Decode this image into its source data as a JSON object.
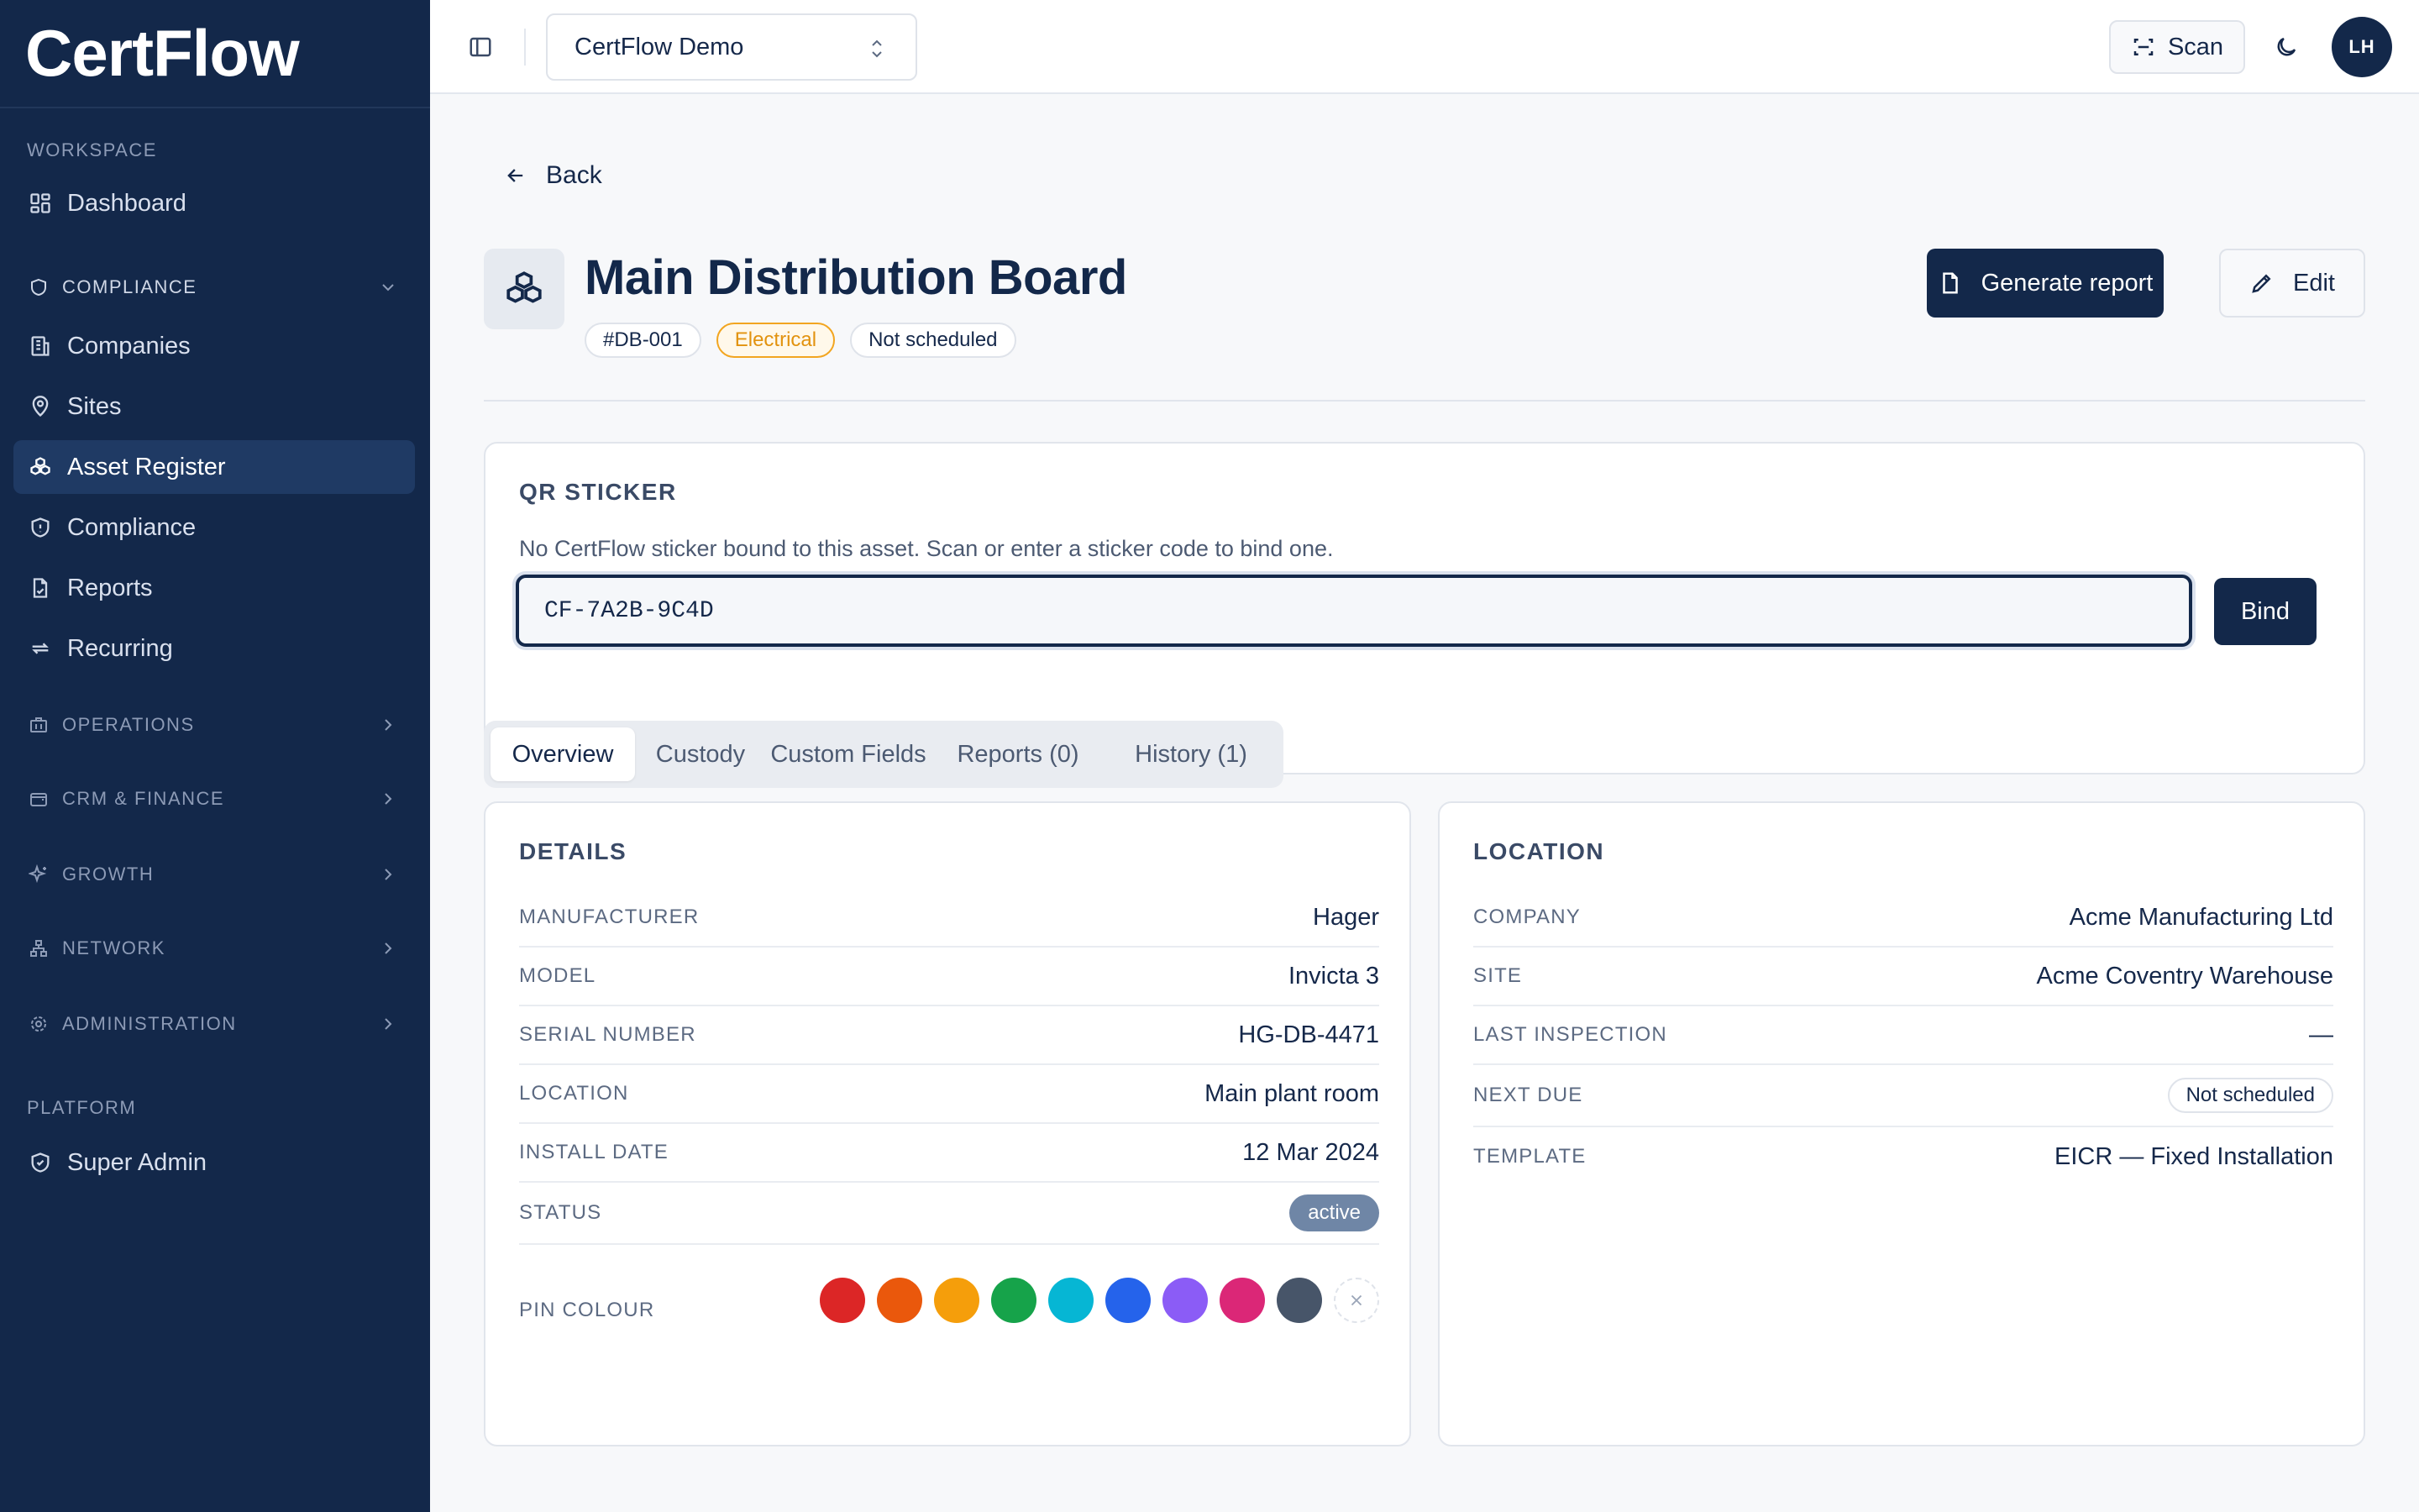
{
  "app": {
    "name": "CertFlow"
  },
  "sidebar": {
    "sections": {
      "workspace": "WORKSPACE",
      "platform": "PLATFORM"
    },
    "dashboard": "Dashboard",
    "compliance_group": "COMPLIANCE",
    "compliance_items": [
      "Companies",
      "Sites",
      "Asset Register",
      "Compliance",
      "Reports",
      "Recurring"
    ],
    "groups": [
      "OPERATIONS",
      "CRM & FINANCE",
      "GROWTH",
      "NETWORK",
      "ADMINISTRATION"
    ],
    "super_admin": "Super Admin",
    "active_item": "Asset Register"
  },
  "topbar": {
    "workspace": "CertFlow Demo",
    "scan_label": "Scan",
    "avatar_initials": "LH"
  },
  "page": {
    "back_label": "Back",
    "title": "Main Distribution Board",
    "tags": {
      "id": "#DB-001",
      "category": "Electrical",
      "schedule": "Not scheduled"
    },
    "generate_report_label": "Generate report",
    "edit_label": "Edit"
  },
  "qr": {
    "title": "QR STICKER",
    "description": "No CertFlow sticker bound to this asset. Scan or enter a sticker code to bind one.",
    "input_value": "CF-7A2B-9C4D",
    "bind_label": "Bind"
  },
  "tabs": [
    "Overview",
    "Custody",
    "Custom Fields",
    "Reports (0)",
    "History (1)"
  ],
  "details": {
    "title": "DETAILS",
    "rows": [
      {
        "label": "MANUFACTURER",
        "value": "Hager"
      },
      {
        "label": "MODEL",
        "value": "Invicta 3"
      },
      {
        "label": "SERIAL NUMBER",
        "value": "HG-DB-4471"
      },
      {
        "label": "LOCATION",
        "value": "Main plant room"
      },
      {
        "label": "INSTALL DATE",
        "value": "12 Mar 2024"
      },
      {
        "label": "STATUS",
        "value": "active"
      },
      {
        "label": "PIN COLOUR"
      }
    ],
    "pin_colours": [
      "#dc2626",
      "#ea580c",
      "#f59e0b",
      "#16a34a",
      "#06b6d4",
      "#2563eb",
      "#8b5cf6",
      "#db2777",
      "#475569"
    ]
  },
  "location": {
    "title": "LOCATION",
    "rows": [
      {
        "label": "COMPANY",
        "value": "Acme Manufacturing Ltd"
      },
      {
        "label": "SITE",
        "value": "Acme Coventry Warehouse"
      },
      {
        "label": "LAST INSPECTION",
        "value": "—"
      },
      {
        "label": "NEXT DUE",
        "value": "Not scheduled"
      },
      {
        "label": "TEMPLATE",
        "value": "EICR — Fixed Installation"
      }
    ]
  },
  "colors": {
    "navy": "#13284a",
    "accent_orange": "#f2a520",
    "status_pill": "#6f86a6"
  }
}
